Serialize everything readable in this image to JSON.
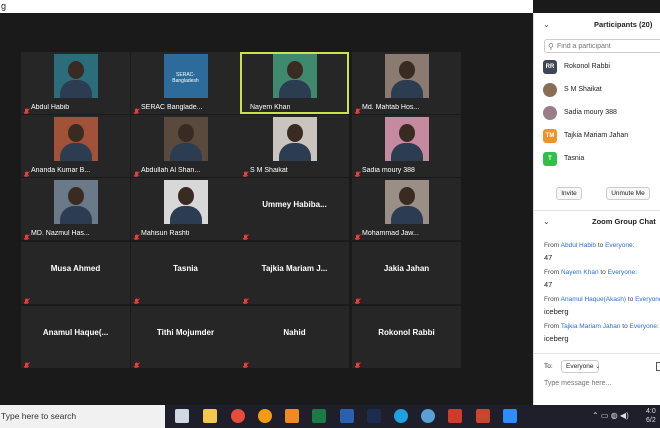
{
  "window": {
    "title_fragment": "g"
  },
  "tiles": [
    {
      "name": "Abdul Habib",
      "kind": "video",
      "muted": true,
      "photo_color": "#2b6d7a"
    },
    {
      "name": "SERAC Banglade...",
      "kind": "logo",
      "muted": true,
      "logo_text": "SERAC-Bangladesh",
      "photo_color": "#2d6b9a"
    },
    {
      "name": "Nayem Khan",
      "kind": "video",
      "muted": false,
      "active": true,
      "photo_color": "#3f8a6f"
    },
    {
      "name": "Md. Mahtab Hos...",
      "kind": "video",
      "muted": true,
      "photo_color": "#8a7a70"
    },
    {
      "name": "Ananda Kumar B...",
      "kind": "video",
      "muted": true,
      "photo_color": "#a15238"
    },
    {
      "name": "Abdullah Al Shan...",
      "kind": "video",
      "muted": true,
      "photo_color": "#5a4a3e"
    },
    {
      "name": "S M Shaikat",
      "kind": "video",
      "muted": true,
      "photo_color": "#c9c4bd"
    },
    {
      "name": "Sadia moury 388",
      "kind": "video",
      "muted": true,
      "photo_color": "#c58aa0"
    },
    {
      "name": "MD. Nazmul Has...",
      "kind": "video",
      "muted": true,
      "photo_color": "#6b7a88"
    },
    {
      "name": "Mahisun Rashti",
      "kind": "video",
      "muted": true,
      "photo_color": "#d8d8d8"
    },
    {
      "name": "Ummey  Habiba...",
      "kind": "name",
      "muted": true
    },
    {
      "name": "Mohammad Jaw...",
      "kind": "video",
      "muted": true,
      "photo_color": "#9a8f86"
    },
    {
      "name": "Musa Ahmed",
      "kind": "name",
      "muted": true
    },
    {
      "name": "Tasnia",
      "kind": "name",
      "muted": true
    },
    {
      "name": "Tajkia  Mariam  J...",
      "kind": "name",
      "muted": true
    },
    {
      "name": "Jakia Jahan",
      "kind": "name",
      "muted": true
    },
    {
      "name": "Anamul  Haque(...",
      "kind": "name",
      "muted": true
    },
    {
      "name": "Tithi Mojumder",
      "kind": "name",
      "muted": true
    },
    {
      "name": "Nahid",
      "kind": "name",
      "muted": true
    },
    {
      "name": "Rokonol Rabbi",
      "kind": "name",
      "muted": true
    }
  ],
  "participants": {
    "title": "Participants (20)",
    "search_placeholder": "Find a participant",
    "list": [
      {
        "name": "Rokonol Rabbi",
        "initials": "RR",
        "color": "#3d4654"
      },
      {
        "name": "S M Shaikat",
        "initials": "",
        "color": "#8a6d55"
      },
      {
        "name": "Sadia moury 388",
        "initials": "",
        "color": "#9b7d8a"
      },
      {
        "name": "Tajkia Mariam Jahan",
        "initials": "TM",
        "color": "#f0932b"
      },
      {
        "name": "Tasnia",
        "initials": "T",
        "color": "#2fbf4a"
      }
    ],
    "invite_label": "Invite",
    "unmute_label": "Unmute Me"
  },
  "chat": {
    "title": "Zoom Group Chat",
    "messages": [
      {
        "from_prefix": "From ",
        "sender": "Abdul Habib",
        "to_word": " to ",
        "recipient": "Everyone:",
        "body": "47"
      },
      {
        "from_prefix": "From ",
        "sender": "Nayem Khan",
        "to_word": " to ",
        "recipient": "Everyone:",
        "body": "47"
      },
      {
        "from_prefix": "From ",
        "sender": "Anamul Haque(Akash)",
        "to_word": " to ",
        "recipient": "Everyone",
        "body": "iceberg"
      },
      {
        "from_prefix": "From ",
        "sender": "Tajkia Mariam Jahan",
        "to_word": " to ",
        "recipient": "Everyone:",
        "body": "iceberg"
      }
    ],
    "to_label": "To:",
    "to_value": "Everyone",
    "input_placeholder": "Type message here..."
  },
  "taskbar": {
    "search_text": "Type here to search",
    "time": "4:0",
    "date": "6/2",
    "apps": [
      {
        "name": "task-view",
        "color": "#cfd8e3"
      },
      {
        "name": "file-explorer",
        "color": "#f2c94c"
      },
      {
        "name": "chrome",
        "color": "#e74c3c"
      },
      {
        "name": "firefox",
        "color": "#f39c12"
      },
      {
        "name": "vlc",
        "color": "#f08a24"
      },
      {
        "name": "excel",
        "color": "#1d7a45"
      },
      {
        "name": "word",
        "color": "#2b5fb0"
      },
      {
        "name": "photoshop",
        "color": "#1b2d4f"
      },
      {
        "name": "skype",
        "color": "#1ea1e0"
      },
      {
        "name": "network-app",
        "color": "#5aa0d8"
      },
      {
        "name": "office",
        "color": "#d13b2b"
      },
      {
        "name": "powerpoint",
        "color": "#c8462b"
      },
      {
        "name": "zoom",
        "color": "#2d8cff"
      }
    ]
  },
  "colors": {
    "active_speaker_border": "#c9e34a",
    "link": "#2d6fd6",
    "mic_muted": "#e8403b"
  }
}
